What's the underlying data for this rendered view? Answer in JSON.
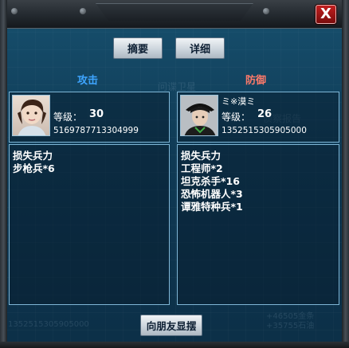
{
  "dialog": {
    "close_label": "X",
    "tabs": [
      {
        "label": "摘要"
      },
      {
        "label": "详细"
      }
    ],
    "attack_label": "攻击",
    "defense_label": "防御",
    "share_label": "向朋友显摆"
  },
  "attacker": {
    "level_label": "等级：",
    "level": "30",
    "id": "5169787713304999",
    "losses": [
      "损失兵力",
      "步枪兵*6"
    ]
  },
  "defender": {
    "name": "ミ※漠ミ",
    "level_label": "等级：",
    "level": "26",
    "id": "1352515305905000",
    "losses": [
      "损失兵力",
      "工程师*2",
      "坦克杀手*16",
      "恐怖机器人*3",
      "谭雅特种兵*1"
    ]
  },
  "background": {
    "ghost_texts": [
      "问谍卫星",
      "侦察报告",
      "1352515305905000",
      "+46505金条",
      "+35755石油"
    ]
  },
  "colors": {
    "attack": "#3ea5ff",
    "defense": "#ff7a6a",
    "panel_border": "#7fb6d6",
    "close": "#c21f1f"
  }
}
